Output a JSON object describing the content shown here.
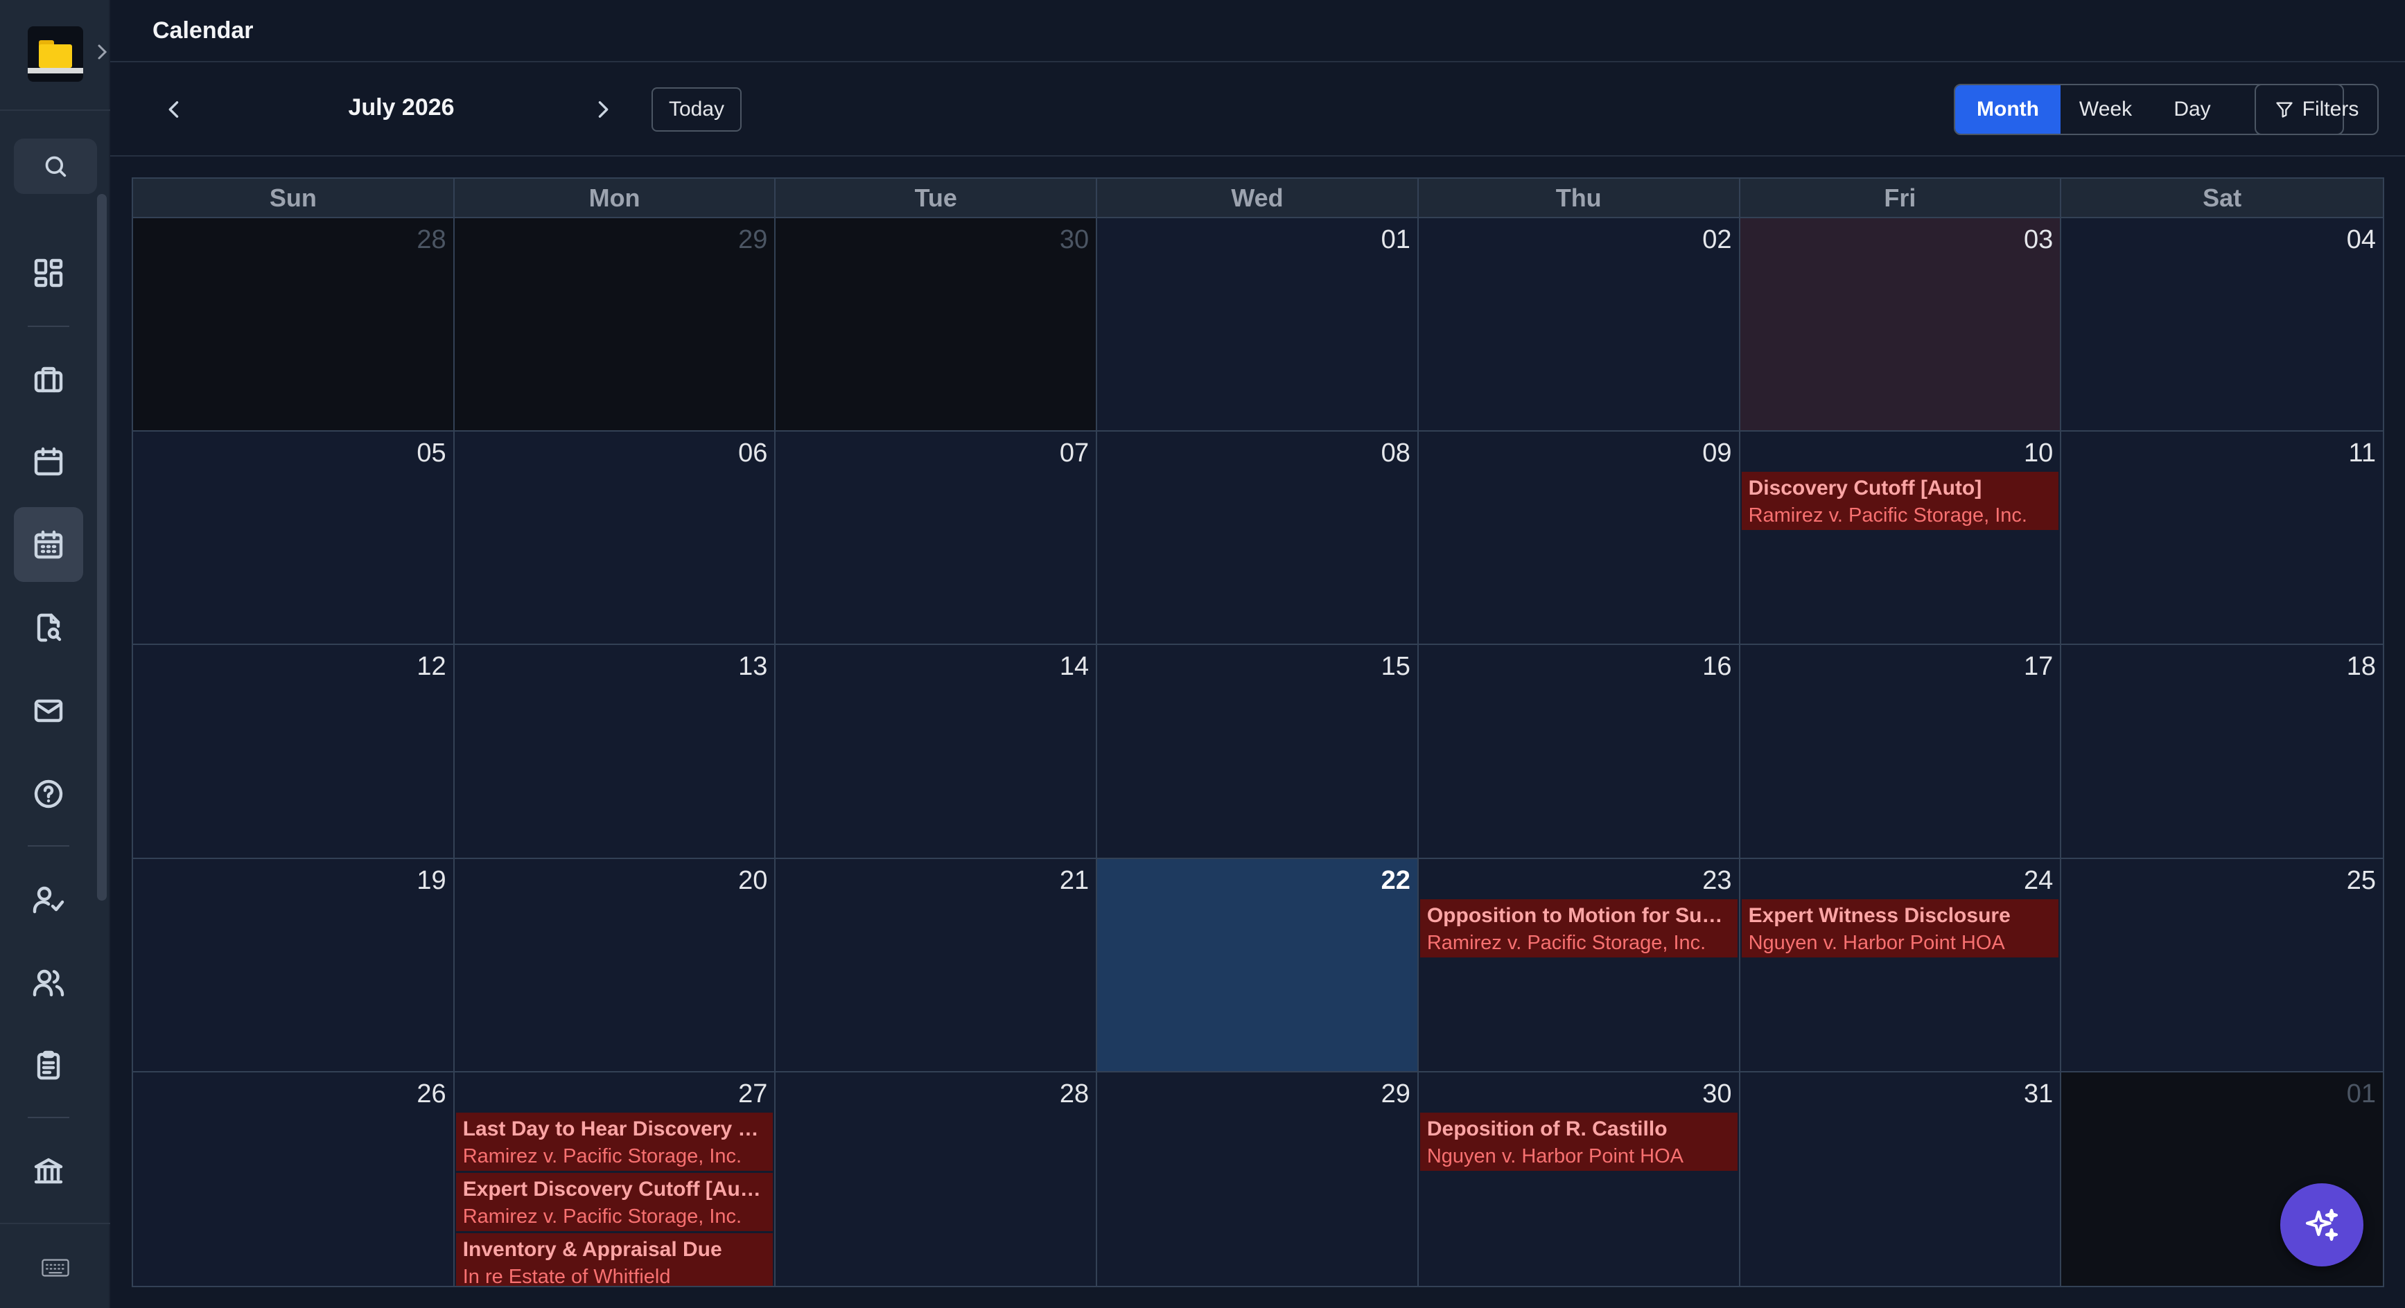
{
  "header": {
    "title": "Calendar"
  },
  "toolbar": {
    "month_label": "July 2026",
    "today_label": "Today",
    "views": [
      {
        "label": "Month",
        "selected": true
      },
      {
        "label": "Week",
        "selected": false
      },
      {
        "label": "Day",
        "selected": false
      }
    ],
    "filters_label": "Filters"
  },
  "sidebar": {
    "items": [
      {
        "icon": "dashboard-icon"
      },
      {
        "icon": "briefcase-icon"
      },
      {
        "icon": "calendar-icon"
      },
      {
        "icon": "calendar-grid-icon",
        "active": true
      },
      {
        "icon": "document-search-icon"
      },
      {
        "icon": "mail-icon"
      },
      {
        "icon": "help-icon"
      },
      {
        "icon": "user-check-icon"
      },
      {
        "icon": "users-icon"
      },
      {
        "icon": "clipboard-icon"
      },
      {
        "icon": "bank-icon"
      }
    ]
  },
  "calendar": {
    "weekdays": [
      "Sun",
      "Mon",
      "Tue",
      "Wed",
      "Thu",
      "Fri",
      "Sat"
    ],
    "weeks": [
      [
        {
          "day": "28",
          "outside": true
        },
        {
          "day": "29",
          "outside": true
        },
        {
          "day": "30",
          "outside": true
        },
        {
          "day": "01"
        },
        {
          "day": "02"
        },
        {
          "day": "03",
          "highlight": true
        },
        {
          "day": "04"
        }
      ],
      [
        {
          "day": "05"
        },
        {
          "day": "06"
        },
        {
          "day": "07"
        },
        {
          "day": "08"
        },
        {
          "day": "09"
        },
        {
          "day": "10",
          "events": [
            {
              "title": "Discovery Cutoff [Auto]",
              "case": "Ramirez v. Pacific Storage, Inc."
            }
          ]
        },
        {
          "day": "11"
        }
      ],
      [
        {
          "day": "12"
        },
        {
          "day": "13"
        },
        {
          "day": "14"
        },
        {
          "day": "15"
        },
        {
          "day": "16"
        },
        {
          "day": "17"
        },
        {
          "day": "18"
        }
      ],
      [
        {
          "day": "19"
        },
        {
          "day": "20"
        },
        {
          "day": "21"
        },
        {
          "day": "22",
          "today": true
        },
        {
          "day": "23",
          "events": [
            {
              "title": "Opposition to Motion for Sum...",
              "case": "Ramirez v. Pacific Storage, Inc."
            }
          ]
        },
        {
          "day": "24",
          "events": [
            {
              "title": "Expert Witness Disclosure",
              "case": "Nguyen v. Harbor Point HOA"
            }
          ]
        },
        {
          "day": "25"
        }
      ],
      [
        {
          "day": "26"
        },
        {
          "day": "27",
          "events": [
            {
              "title": "Last Day to Hear Discovery M...",
              "case": "Ramirez v. Pacific Storage, Inc."
            },
            {
              "title": "Expert Discovery Cutoff [Auto]",
              "case": "Ramirez v. Pacific Storage, Inc."
            },
            {
              "title": "Inventory & Appraisal Due",
              "case": "In re Estate of Whitfield"
            }
          ]
        },
        {
          "day": "28"
        },
        {
          "day": "29"
        },
        {
          "day": "30",
          "events": [
            {
              "title": "Deposition of R. Castillo",
              "case": "Nguyen v. Harbor Point HOA"
            }
          ]
        },
        {
          "day": "31"
        },
        {
          "day": "01",
          "outside": true
        }
      ]
    ]
  },
  "colors": {
    "accent": "#2563eb",
    "event_bg": "#5b1010",
    "event_title": "#fca5a5",
    "event_case": "#f87171",
    "today_bg": "#1e3a5f",
    "fab": "#5b47d6"
  }
}
